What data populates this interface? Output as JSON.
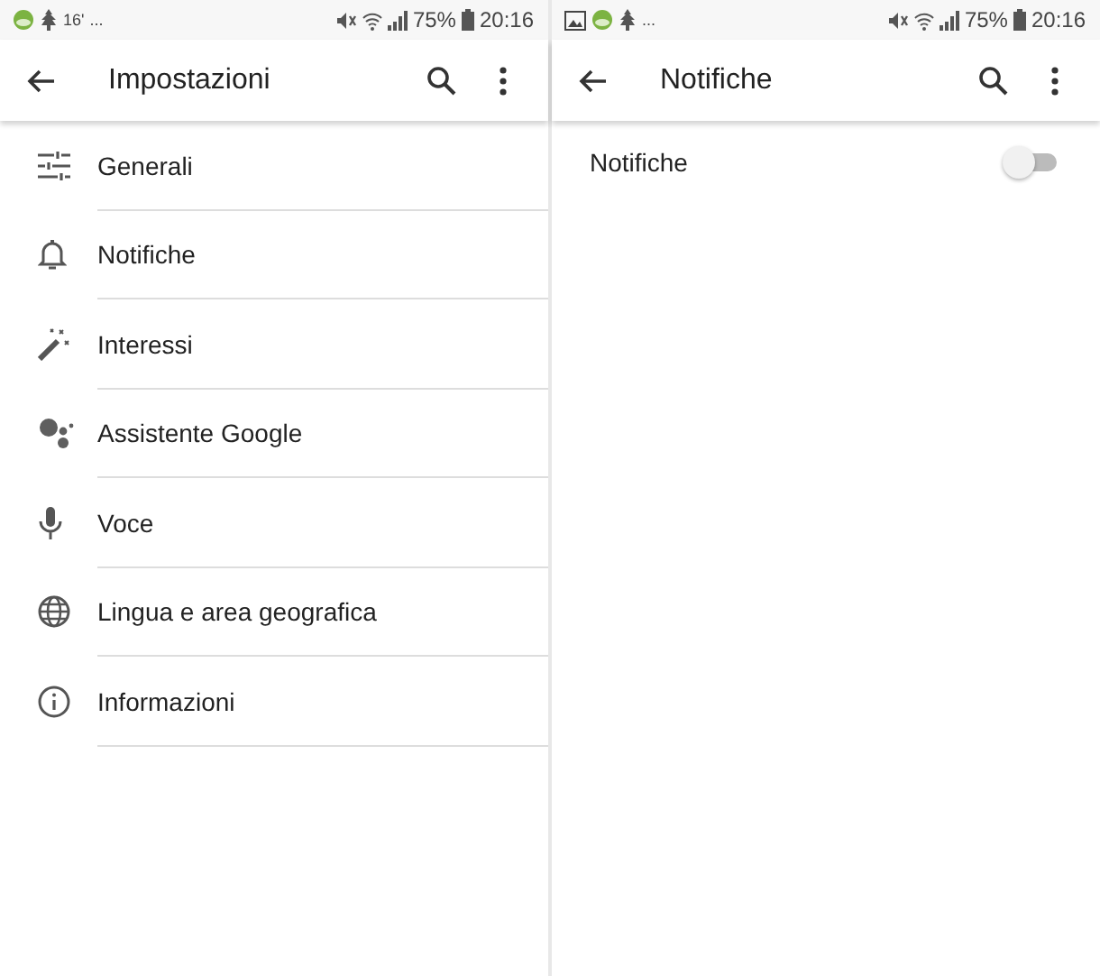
{
  "panes": [
    {
      "status_bar": {
        "left_texts": [
          "16'",
          "..."
        ],
        "battery": "75%",
        "time": "20:16"
      },
      "title": "Impostazioni",
      "settings_items": [
        {
          "label": "Generali",
          "kind": "sliders"
        },
        {
          "label": "Notifiche",
          "kind": "bell"
        },
        {
          "label": "Interessi",
          "kind": "wand"
        },
        {
          "label": "Assistente Google",
          "kind": "assistant"
        },
        {
          "label": "Voce",
          "kind": "mic"
        },
        {
          "label": "Lingua e area geografica",
          "kind": "globe"
        },
        {
          "label": "Informazioni",
          "kind": "info"
        }
      ]
    },
    {
      "status_bar": {
        "left_texts": [
          "..."
        ],
        "battery": "75%",
        "time": "20:16"
      },
      "title": "Notifiche",
      "toggles": [
        {
          "label": "Notifiche",
          "on": false
        }
      ]
    }
  ]
}
